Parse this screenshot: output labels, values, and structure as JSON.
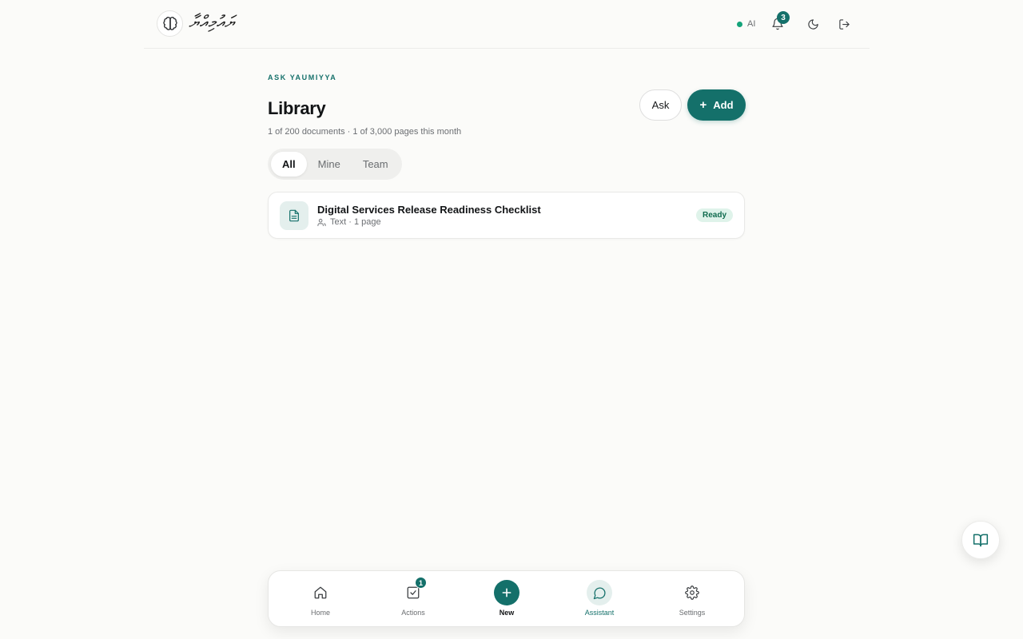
{
  "header": {
    "logo_text": "ޔައުމިއްޔާ",
    "ai_status": "AI",
    "notification_count": "3"
  },
  "main": {
    "eyebrow": "ASK YAUMIYYA",
    "title": "Library",
    "subtitle": "1 of 200 documents · 1 of 3,000 pages this month",
    "ask_button": "Ask",
    "add_button": "Add",
    "tabs": [
      {
        "label": "All",
        "active": true
      },
      {
        "label": "Mine",
        "active": false
      },
      {
        "label": "Team",
        "active": false
      }
    ],
    "documents": [
      {
        "title": "Digital Services Release Readiness Checklist",
        "meta": "Text · 1 page",
        "status": "Ready"
      }
    ]
  },
  "bottom_nav": {
    "items": [
      {
        "label": "Home",
        "icon": "home-icon"
      },
      {
        "label": "Actions",
        "icon": "checkbox-icon",
        "badge": "1"
      },
      {
        "label": "New",
        "icon": "plus-icon"
      },
      {
        "label": "Assistant",
        "icon": "chat-bubble-icon"
      },
      {
        "label": "Settings",
        "icon": "gear-icon"
      }
    ]
  },
  "colors": {
    "accent": "#14706a",
    "background": "#fbfbf9",
    "status_ready_bg": "#dff3ea",
    "ai_dot": "#14a37a"
  }
}
